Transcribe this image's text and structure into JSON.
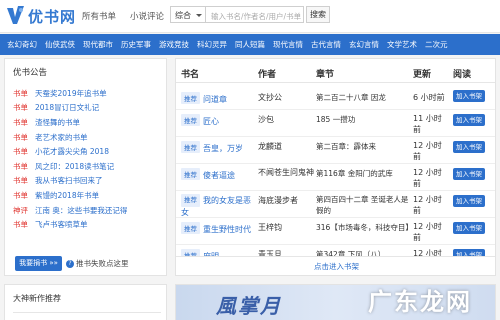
{
  "site": {
    "logo_text": "优书网"
  },
  "header": {
    "links": [
      "所有书单",
      "小说评论"
    ],
    "search_category": "综合",
    "search_placeholder": "输入书名/作者名/用户/书单",
    "search_button": "搜索"
  },
  "nav": {
    "items": [
      "玄幻奇幻",
      "仙侠武侠",
      "现代都市",
      "历史军事",
      "游戏竞技",
      "科幻灵异",
      "同人短篇",
      "现代言情",
      "古代言情",
      "玄幻言情",
      "文学艺术",
      "二次元"
    ]
  },
  "notices": {
    "title": "优书公告",
    "items": [
      {
        "tag": "书单",
        "text": "天蚕奖2019年追书单"
      },
      {
        "tag": "书单",
        "text": "2018冒订日文礼记"
      },
      {
        "tag": "书单",
        "text": "渣怪舞的书单"
      },
      {
        "tag": "书单",
        "text": "老艺术家的书单"
      },
      {
        "tag": "书单",
        "text": "小花才露尖尖角 2018"
      },
      {
        "tag": "书单",
        "text": "风之印：2018读书笔记"
      },
      {
        "tag": "书单",
        "text": "我从书客扫书回来了"
      },
      {
        "tag": "书单",
        "text": "紫馒的2018年书单"
      },
      {
        "tag": "神评",
        "text": "江南 奥：这些书要我还记得"
      },
      {
        "tag": "书单",
        "text": "飞卢书客喷草单"
      }
    ],
    "donate_button": "我要捐书 »»",
    "help_text": "推书失败点这里"
  },
  "sidebar2": {
    "title": "大神新作推荐"
  },
  "table": {
    "headers": {
      "title": "书名",
      "author": "作者",
      "chapter": "章节",
      "updated": "更新",
      "read": "阅读"
    },
    "badge": "推荐",
    "add_label": "加入书架",
    "rows": [
      {
        "title": "问道章",
        "author": "文抄公",
        "chapter": "第二百二十八章 因龙",
        "updated": "6 小时前"
      },
      {
        "title": "匠心",
        "author": "沙包",
        "chapter": "185 一攒功",
        "updated": "11 小时前"
      },
      {
        "title": "吾皇，万岁",
        "author": "龙麟道",
        "chapter": "第二百章：霹体来",
        "updated": "12 小时前"
      },
      {
        "title": "傻者逼途",
        "author": "不闻苍生问鬼神",
        "chapter": "第116章 金阳门的武库",
        "updated": "12 小时前"
      },
      {
        "title": "我的女友是恶女",
        "author": "海底漫步者",
        "chapter": "第四百四十二章 圣诞老人是假的",
        "updated": "12 小时前"
      },
      {
        "title": "重生野性时代",
        "author": "王梓钧",
        "chapter": "316【市场毒冬，科技夺目】",
        "updated": "12 小时前"
      },
      {
        "title": "庶明",
        "author": "青玉旦",
        "chapter": "第342章 下风（八）",
        "updated": "12 小时前"
      }
    ],
    "more_label": "点击进入书架"
  },
  "banner": {
    "text": "風掌月"
  },
  "watermark": {
    "text": "广东龙网"
  },
  "colors": {
    "brand_blue": "#2c6fcb",
    "tag_red": "#e0332e"
  }
}
